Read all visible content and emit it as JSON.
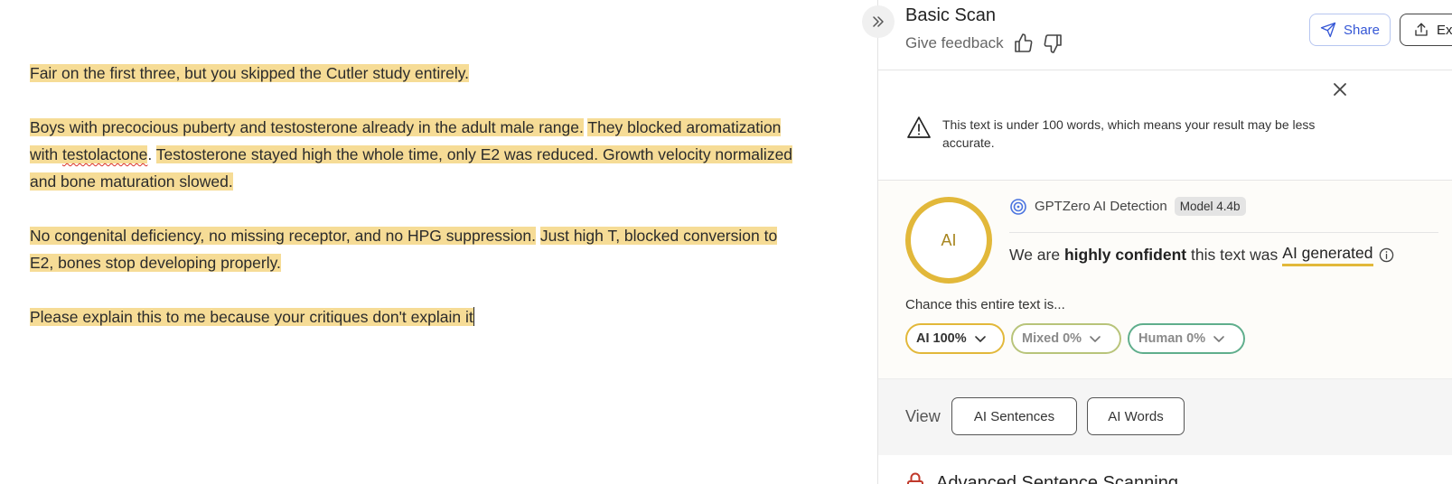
{
  "editor": {
    "paragraphs": [
      [
        "Fair on the first three, but you skipped the Cutler study entirely."
      ],
      [
        "Boys with precocious puberty and testosterone already in the adult male range.",
        "They blocked aromatization with testolactone.",
        "Testosterone stayed high the whole time, only E2 was reduced. Growth velocity normalized and bone maturation slowed."
      ],
      [
        "No congenital deficiency, no missing receptor, and no HPG suppression.",
        "Just high T, blocked conversion to E2, bones stop developing properly."
      ],
      [
        "Please explain this to me because your critiques don't explain it"
      ]
    ],
    "p2s2_before": "They blocked aromatization with ",
    "p2s2_flagged": "testolactone",
    "p2s2_after": ".",
    "highlight_color": "#f6dc96"
  },
  "header": {
    "title": "Basic Scan",
    "feedback_label": "Give feedback",
    "share_label": "Share",
    "export_label": "Exp"
  },
  "warning": {
    "text": "This text is under 100 words, which means your result may be less accurate."
  },
  "result": {
    "ring_label": "AI",
    "detector_name": "GPTZero AI Detection",
    "model_badge": "Model 4.4b",
    "verdict_prefix": "We are",
    "verdict_strong": "highly confident",
    "verdict_middle": "this text was",
    "verdict_label": "AI generated",
    "chance_label": "Chance this entire text is...",
    "pills": [
      {
        "label": "AI 100%",
        "color": "#e2b83a"
      },
      {
        "label": "Mixed 0%",
        "color": "#b8c47a"
      },
      {
        "label": "Human 0%",
        "color": "#5fae8c"
      }
    ]
  },
  "view": {
    "label": "View",
    "buttons": [
      "AI Sentences",
      "AI Words"
    ]
  },
  "advanced": {
    "title": "Advanced Sentence Scanning"
  }
}
